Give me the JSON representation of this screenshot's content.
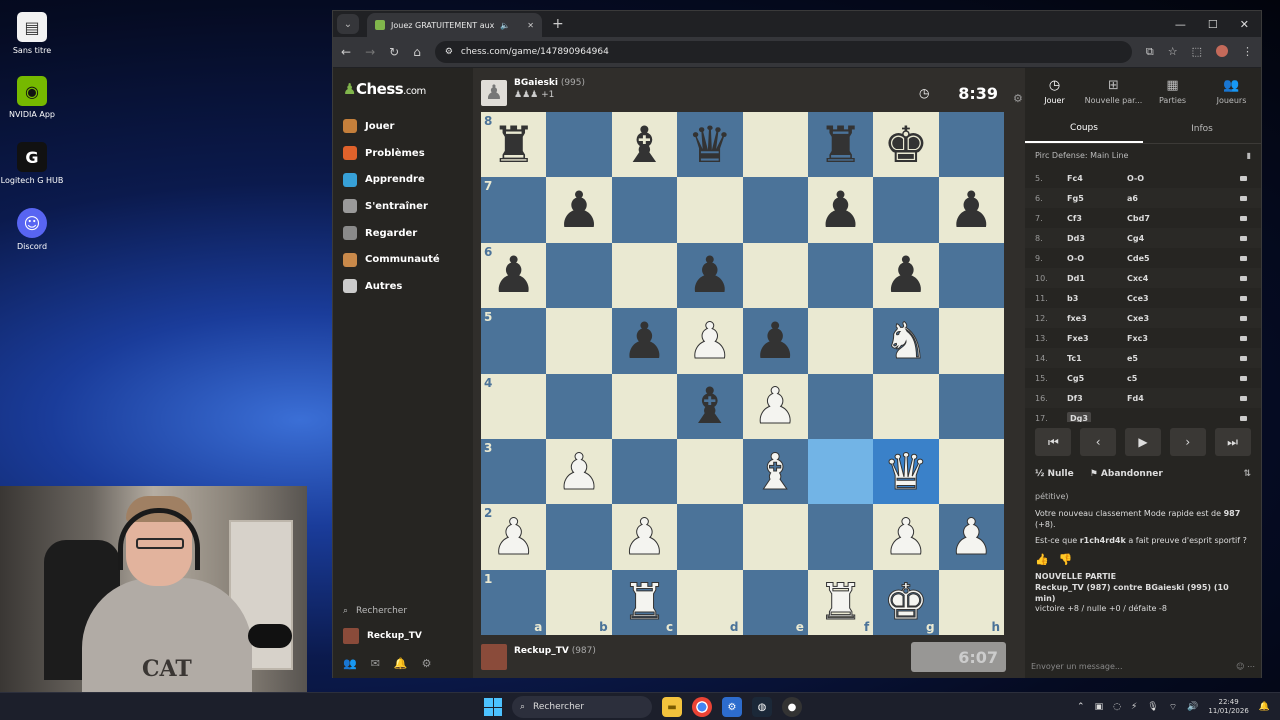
{
  "desktop": {
    "icons": [
      {
        "label": "Sans titre",
        "icon": "notepad-icon"
      },
      {
        "label": "NVIDIA App",
        "icon": "nvidia-icon"
      },
      {
        "label": "Logitech G HUB",
        "icon": "logitech-icon"
      },
      {
        "label": "Discord",
        "icon": "discord-icon"
      }
    ]
  },
  "browser": {
    "tab_title": "Jouez GRATUITEMENT aux",
    "url": "chess.com/game/147890964964"
  },
  "site": {
    "logo_main": "Chess",
    "logo_domain": ".com",
    "nav": [
      {
        "label": "Jouer",
        "color": "#c47f3b"
      },
      {
        "label": "Problèmes",
        "color": "#e0622b"
      },
      {
        "label": "Apprendre",
        "color": "#37a1d8"
      },
      {
        "label": "S'entraîner",
        "color": "#9a9a9a"
      },
      {
        "label": "Regarder",
        "color": "#8a8a8a"
      },
      {
        "label": "Communauté",
        "color": "#c9894a"
      },
      {
        "label": "Autres",
        "color": "#cccccc"
      }
    ],
    "search_label": "Rechercher",
    "username": "Reckup_TV"
  },
  "game": {
    "top_player": {
      "name": "BGaieski",
      "rating": "(995)",
      "captured": "♟♟♟ +1",
      "clock": "8:39"
    },
    "bottom_player": {
      "name": "Reckup_TV",
      "rating": "(987)",
      "clock": "6:07"
    },
    "files": [
      "a",
      "b",
      "c",
      "d",
      "e",
      "f",
      "g",
      "h"
    ],
    "ranks": [
      "8",
      "7",
      "6",
      "5",
      "4",
      "3",
      "2",
      "1"
    ],
    "position": [
      [
        "br",
        "",
        "bb",
        "bq",
        "",
        "br",
        "bk",
        ""
      ],
      [
        "",
        "bp",
        "",
        "",
        "",
        "bp",
        "",
        "bp"
      ],
      [
        "bp",
        "",
        "",
        "bp",
        "",
        "",
        "bp",
        ""
      ],
      [
        "",
        "",
        "bp",
        "wp",
        "bp",
        "",
        "wn",
        ""
      ],
      [
        "",
        "",
        "",
        "bb",
        "wp",
        "",
        "",
        ""
      ],
      [
        "",
        "wp",
        "",
        "",
        "wb",
        "",
        "wq",
        ""
      ],
      [
        "wp",
        "",
        "wp",
        "",
        "",
        "",
        "wp",
        "wp"
      ],
      [
        "",
        "",
        "wr",
        "",
        "",
        "wr",
        "wk",
        ""
      ]
    ],
    "highlight": [
      "f3",
      "g3"
    ],
    "colors": {
      "light": "#eae9d2",
      "dark": "#4b7399",
      "accent": "#81b64c"
    }
  },
  "panel": {
    "tabs": [
      {
        "label": "Jouer",
        "icon": "clock-icon",
        "glyph": "◷"
      },
      {
        "label": "Nouvelle par...",
        "icon": "plus-icon",
        "glyph": "⊞"
      },
      {
        "label": "Parties",
        "icon": "board-icon",
        "glyph": "▦"
      },
      {
        "label": "Joueurs",
        "icon": "players-icon",
        "glyph": "👥"
      }
    ],
    "subtabs": [
      "Coups",
      "Infos"
    ],
    "opening": "Pirc Defense: Main Line",
    "moves": [
      {
        "n": "5.",
        "w": "Fc4",
        "b": "O-O"
      },
      {
        "n": "6.",
        "w": "Fg5",
        "b": "a6"
      },
      {
        "n": "7.",
        "w": "Cf3",
        "b": "Cbd7"
      },
      {
        "n": "8.",
        "w": "Dd3",
        "b": "Cg4"
      },
      {
        "n": "9.",
        "w": "O-O",
        "b": "Cde5"
      },
      {
        "n": "10.",
        "w": "Dd1",
        "b": "Cxc4"
      },
      {
        "n": "11.",
        "w": "b3",
        "b": "Cce3"
      },
      {
        "n": "12.",
        "w": "fxe3",
        "b": "Cxe3"
      },
      {
        "n": "13.",
        "w": "Fxe3",
        "b": "Fxc3"
      },
      {
        "n": "14.",
        "w": "Tc1",
        "b": "e5"
      },
      {
        "n": "15.",
        "w": "Cg5",
        "b": "c5"
      },
      {
        "n": "16.",
        "w": "Df3",
        "b": "Fd4"
      },
      {
        "n": "17.",
        "w": "Dg3",
        "b": ""
      }
    ],
    "draw_label": "Nulle",
    "draw_prefix": "½",
    "resign_label": "Abandonner",
    "chat": {
      "line0": "pétitive)",
      "line1": "Votre nouveau classement Mode rapide est de ",
      "line1_val": "987",
      "line1_delta": "(+8).",
      "line2_a": "Est-ce que ",
      "line2_user": "r1ch4rd4k",
      "line2_b": " a fait preuve d'esprit sportif ?",
      "new_game_title": "NOUVELLE PARTIE",
      "new_game_line": "Reckup_TV (987) contre BGaieski (995) (10 min)",
      "new_game_score": "victoire +8 / nulle +0 / défaite -8"
    },
    "chat_placeholder": "Envoyer un message..."
  },
  "webcam": {
    "shirt_logo": "CAT"
  },
  "taskbar": {
    "search_label": "Rechercher",
    "time": "22:49",
    "date": "11/01/2026"
  }
}
